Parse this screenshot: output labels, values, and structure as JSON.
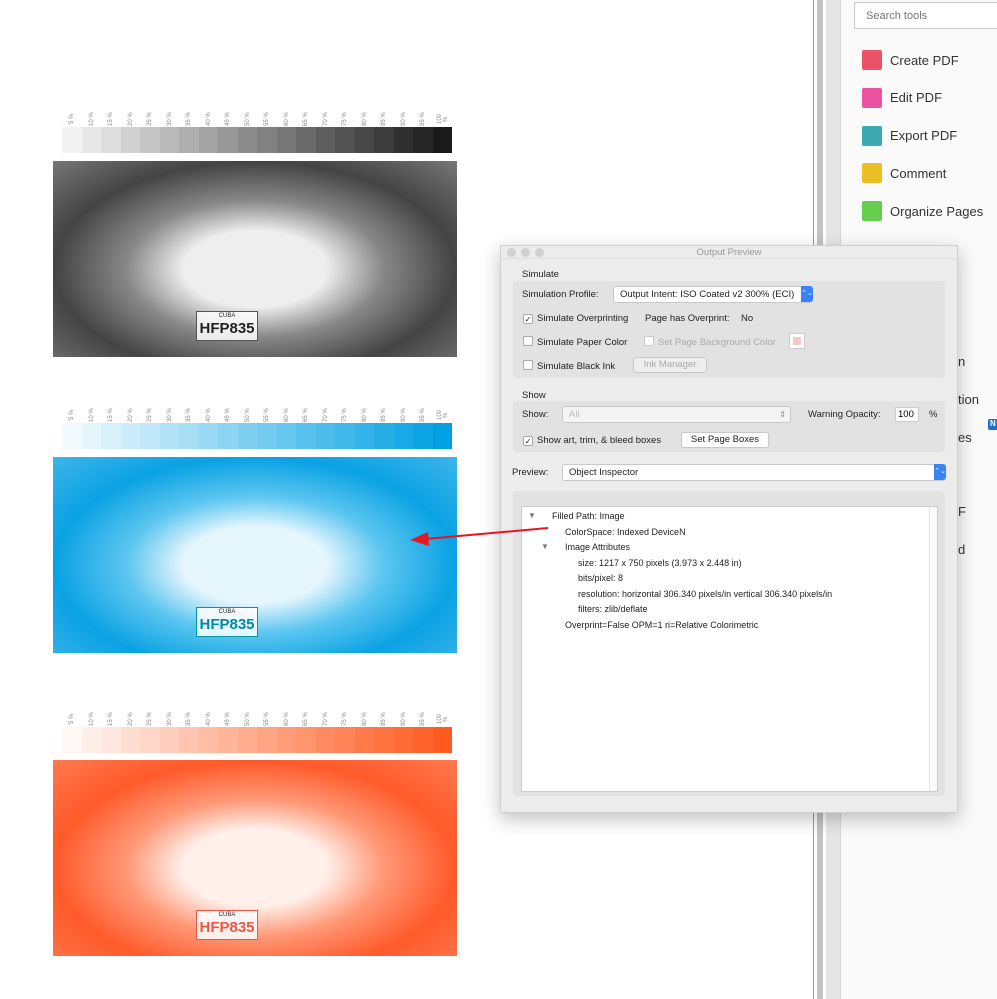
{
  "ramp_labels": [
    "5 %",
    "10 %",
    "15 %",
    "20 %",
    "25 %",
    "30 %",
    "35 %",
    "40 %",
    "45 %",
    "50 %",
    "55 %",
    "60 %",
    "65 %",
    "70 %",
    "75 %",
    "80 %",
    "85 %",
    "90 %",
    "95 %",
    "100 %"
  ],
  "ramps": [
    {
      "name": "black",
      "color": "#1a1a1a"
    },
    {
      "name": "cyan",
      "color": "#00a0e3"
    },
    {
      "name": "red",
      "color": "#ff5a1f"
    }
  ],
  "photo": {
    "plate_top": "CUBA",
    "plate_number": "HFP835"
  },
  "tools_panel": {
    "search_placeholder": "Search tools",
    "items": [
      {
        "label": "Create PDF",
        "icon": "create-pdf-icon",
        "color": "#e8344e"
      },
      {
        "label": "Edit PDF",
        "icon": "edit-pdf-icon",
        "color": "#e8348e"
      },
      {
        "label": "Export PDF",
        "icon": "export-pdf-icon",
        "color": "#1b9aa6"
      },
      {
        "label": "Comment",
        "icon": "comment-icon",
        "color": "#e8b400"
      },
      {
        "label": "Organize Pages",
        "icon": "organize-pages-icon",
        "color": "#4cc42e"
      }
    ],
    "partial_items": [
      "n",
      "tion",
      "es",
      "F",
      "d"
    ],
    "badge": "N"
  },
  "dialog": {
    "title": "Output Preview",
    "simulate": {
      "heading": "Simulate",
      "profile_label": "Simulation Profile:",
      "profile_value": "Output Intent: ISO Coated v2 300% (ECI)",
      "overprinting_label": "Simulate Overprinting",
      "overprinting_checked": true,
      "page_has_overprint_label": "Page has Overprint:",
      "page_has_overprint_value": "No",
      "paper_color_label": "Simulate Paper Color",
      "paper_color_checked": false,
      "bg_color_label": "Set Page Background Color",
      "bg_color_swatch": "#f2c9c9",
      "black_ink_label": "Simulate Black Ink",
      "black_ink_checked": false,
      "ink_manager_label": "Ink Manager"
    },
    "show": {
      "heading": "Show",
      "show_label": "Show:",
      "show_value": "All",
      "warning_opacity_label": "Warning Opacity:",
      "warning_opacity_value": "100",
      "percent": "%",
      "boxes_label": "Show art, trim, & bleed boxes",
      "boxes_checked": true,
      "set_page_boxes_label": "Set Page Boxes"
    },
    "preview": {
      "label": "Preview:",
      "value": "Object Inspector"
    },
    "inspector": [
      "Filled Path: Image",
      "ColorSpace: Indexed DeviceN",
      "Image Attributes",
      "size: 1217 x 750 pixels (3.973 x 2.448 in)",
      "bits/pixel: 8",
      "resolution: horizontal 306.340 pixels/in vertical 306.340 pixels/in",
      "filters: zlib/deflate",
      "Overprint=False OPM=1 ri=Relative Colorimetric"
    ]
  },
  "annotation_arrow_color": "#e8141e"
}
